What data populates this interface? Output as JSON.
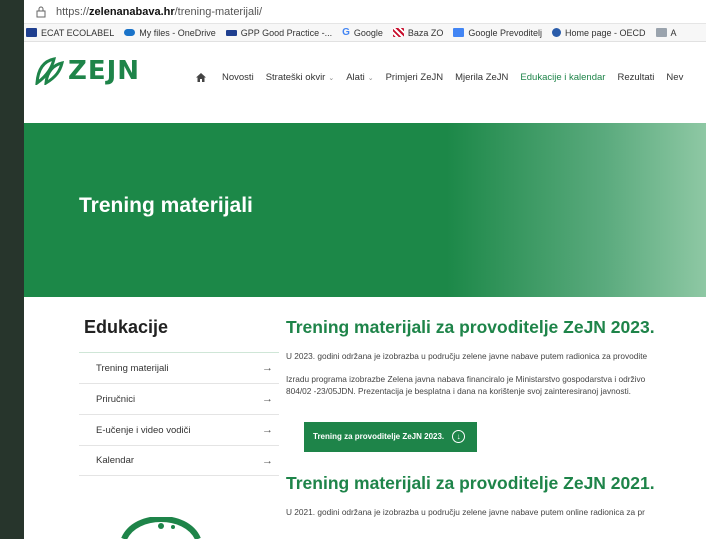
{
  "browser": {
    "url_prefix": "https://",
    "url_domain": "zelenanabava.hr",
    "url_path": "/trening-materijali/"
  },
  "bookmarks": [
    {
      "label": "ECAT ECOLABEL",
      "icon": "eu-flag-icon",
      "color": "#1f3f8f"
    },
    {
      "label": "My files - OneDrive",
      "icon": "onedrive-cloud-icon",
      "color": "#1a73c9"
    },
    {
      "label": "GPP Good Practice -...",
      "icon": "eu-flag-icon",
      "color": "#1f3f8f"
    },
    {
      "label": "Google",
      "icon": "google-g-icon",
      "color": "#4285f4"
    },
    {
      "label": "Baza ZO",
      "icon": "croatia-shield-icon",
      "color": "#c8102e"
    },
    {
      "label": "Google Prevoditelj",
      "icon": "google-translate-icon",
      "color": "#4285f4"
    },
    {
      "label": "Home page - OECD",
      "icon": "oecd-icon",
      "color": "#2a5caa"
    },
    {
      "label": "A",
      "icon": "site-icon",
      "color": "#9aa3ad"
    }
  ],
  "site": {
    "logo_text": "ZEJN",
    "nav": [
      {
        "label": "Novosti",
        "dropdown": false
      },
      {
        "label": "Strateški okvir",
        "dropdown": true
      },
      {
        "label": "Alati",
        "dropdown": true
      },
      {
        "label": "Primjeri ZeJN",
        "dropdown": false
      },
      {
        "label": "Mjerila ZeJN",
        "dropdown": false
      },
      {
        "label": "Edukacije i kalendar",
        "dropdown": false,
        "active": true
      },
      {
        "label": "Rezultati",
        "dropdown": false
      },
      {
        "label": "Nev",
        "dropdown": false
      }
    ]
  },
  "hero": {
    "title": "Trening materijali"
  },
  "sidebar": {
    "title": "Edukacije",
    "items": [
      {
        "label": "Trening materijali"
      },
      {
        "label": "Priručnici"
      },
      {
        "label": "E-učenje i video vodiči"
      },
      {
        "label": "Kalendar"
      }
    ],
    "arrow": "→"
  },
  "content": {
    "section_2023_title": "Trening materijali za provoditelje ZeJN 2023.",
    "section_2023_p1": "U 2023. godini održana je izobrazba u području zelene javne nabave putem radionica za provodite",
    "section_2023_p2_line1": "Izradu programa izobrazbe Zelena javna nabava financiralo je Ministarstvo gospodarstva i održivo",
    "section_2023_p2_line2": "804/02 -23/05JDN. Prezentacija je besplatna i dana na korištenje svoj zainteresiranoj javnosti.",
    "download_button_label": "Trening za provoditelje ZeJN 2023.",
    "section_2021_title": "Trening materijali za provoditelje ZeJN 2021.",
    "section_2021_p1": "U 2021. godini održana je izobrazba u području zelene javne nabave putem online radionica za pr"
  },
  "colors": {
    "brand_green": "#1e8449",
    "page_background": "#27352c"
  }
}
